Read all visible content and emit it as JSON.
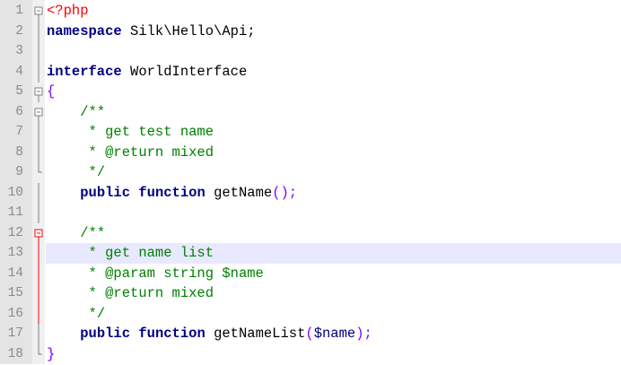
{
  "editor": {
    "lines": [
      {
        "number": "1",
        "tokens": [
          {
            "cls": "php-tag",
            "text": "<?php"
          }
        ]
      },
      {
        "number": "2",
        "tokens": [
          {
            "cls": "kw",
            "text": "namespace"
          },
          {
            "cls": "plain",
            "text": " Silk\\Hello\\Api;"
          }
        ]
      },
      {
        "number": "3",
        "tokens": []
      },
      {
        "number": "4",
        "tokens": [
          {
            "cls": "kw",
            "text": "interface"
          },
          {
            "cls": "plain",
            "text": " WorldInterface"
          }
        ]
      },
      {
        "number": "5",
        "tokens": [
          {
            "cls": "brace",
            "text": "{"
          }
        ]
      },
      {
        "number": "6",
        "tokens": [
          {
            "cls": "plain",
            "text": "    "
          },
          {
            "cls": "comment",
            "text": "/**"
          }
        ]
      },
      {
        "number": "7",
        "tokens": [
          {
            "cls": "plain",
            "text": "     "
          },
          {
            "cls": "comment",
            "text": "* get test name"
          }
        ]
      },
      {
        "number": "8",
        "tokens": [
          {
            "cls": "plain",
            "text": "     "
          },
          {
            "cls": "comment",
            "text": "* @return mixed"
          }
        ]
      },
      {
        "number": "9",
        "tokens": [
          {
            "cls": "plain",
            "text": "     "
          },
          {
            "cls": "comment",
            "text": "*/"
          }
        ]
      },
      {
        "number": "10",
        "tokens": [
          {
            "cls": "plain",
            "text": "    "
          },
          {
            "cls": "kw",
            "text": "public"
          },
          {
            "cls": "plain",
            "text": " "
          },
          {
            "cls": "kw",
            "text": "function"
          },
          {
            "cls": "plain",
            "text": " getName"
          },
          {
            "cls": "op",
            "text": "();"
          }
        ]
      },
      {
        "number": "11",
        "tokens": []
      },
      {
        "number": "12",
        "tokens": [
          {
            "cls": "plain",
            "text": "    "
          },
          {
            "cls": "comment",
            "text": "/**"
          }
        ]
      },
      {
        "number": "13",
        "tokens": [
          {
            "cls": "plain",
            "text": "     "
          },
          {
            "cls": "comment",
            "text": "* get name list"
          }
        ]
      },
      {
        "number": "14",
        "tokens": [
          {
            "cls": "plain",
            "text": "     "
          },
          {
            "cls": "comment",
            "text": "* @param string $name"
          }
        ]
      },
      {
        "number": "15",
        "tokens": [
          {
            "cls": "plain",
            "text": "     "
          },
          {
            "cls": "comment",
            "text": "* @return mixed"
          }
        ]
      },
      {
        "number": "16",
        "tokens": [
          {
            "cls": "plain",
            "text": "     "
          },
          {
            "cls": "comment",
            "text": "*/"
          }
        ]
      },
      {
        "number": "17",
        "tokens": [
          {
            "cls": "plain",
            "text": "    "
          },
          {
            "cls": "kw",
            "text": "public"
          },
          {
            "cls": "plain",
            "text": " "
          },
          {
            "cls": "kw",
            "text": "function"
          },
          {
            "cls": "plain",
            "text": " getNameList"
          },
          {
            "cls": "op",
            "text": "("
          },
          {
            "cls": "var",
            "text": "$name"
          },
          {
            "cls": "op",
            "text": ");"
          }
        ]
      },
      {
        "number": "18",
        "tokens": [
          {
            "cls": "brace",
            "text": "}"
          }
        ]
      }
    ],
    "current_line": "13",
    "colors": {
      "keyword": "#000080",
      "comment": "#008000",
      "php_tag": "#ff0000",
      "operator": "#8000ff",
      "current_line_highlight": "#e8e8ff",
      "gutter": "#e4e4e4"
    }
  }
}
